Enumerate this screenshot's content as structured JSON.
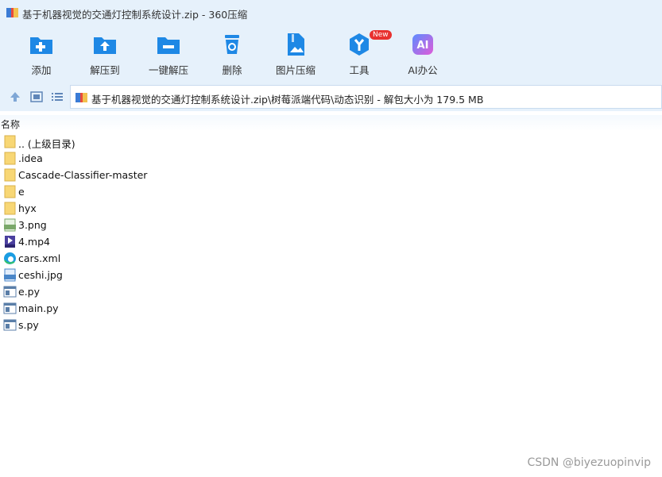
{
  "window": {
    "title": "基于机器视觉的交通灯控制系统设计.zip - 360压缩"
  },
  "toolbar": {
    "items": [
      {
        "label": "添加",
        "icon": "add-icon"
      },
      {
        "label": "解压到",
        "icon": "extract-to-icon"
      },
      {
        "label": "一键解压",
        "icon": "one-click-extract-icon"
      },
      {
        "label": "删除",
        "icon": "delete-icon"
      },
      {
        "label": "图片压缩",
        "icon": "image-compress-icon"
      },
      {
        "label": "工具",
        "icon": "tools-icon",
        "badge": "New"
      },
      {
        "label": "AI办公",
        "icon": "ai-office-icon",
        "glyph": "AI"
      }
    ]
  },
  "address": {
    "path": "基于机器视觉的交通灯控制系统设计.zip\\树莓派端代码\\动态识别 - 解包大小为 179.5 MB"
  },
  "columns": {
    "name": "名称"
  },
  "files": [
    {
      "name": ".. (上级目录)",
      "type": "folder"
    },
    {
      "name": ".idea",
      "type": "folder"
    },
    {
      "name": "Cascade-Classifier-master",
      "type": "folder"
    },
    {
      "name": "e",
      "type": "folder"
    },
    {
      "name": "hyx",
      "type": "folder"
    },
    {
      "name": "3.png",
      "type": "png"
    },
    {
      "name": "4.mp4",
      "type": "mp4"
    },
    {
      "name": "cars.xml",
      "type": "xml"
    },
    {
      "name": "ceshi.jpg",
      "type": "jpg"
    },
    {
      "name": "e.py",
      "type": "py"
    },
    {
      "name": "main.py",
      "type": "py"
    },
    {
      "name": "s.py",
      "type": "py"
    }
  ],
  "watermark": "CSDN @biyezuopinvip",
  "colors": {
    "accent": "#1e88e5",
    "toolbar_bg": "#e6f1fb",
    "folder": "#f8d775",
    "badge": "#e8312f"
  }
}
